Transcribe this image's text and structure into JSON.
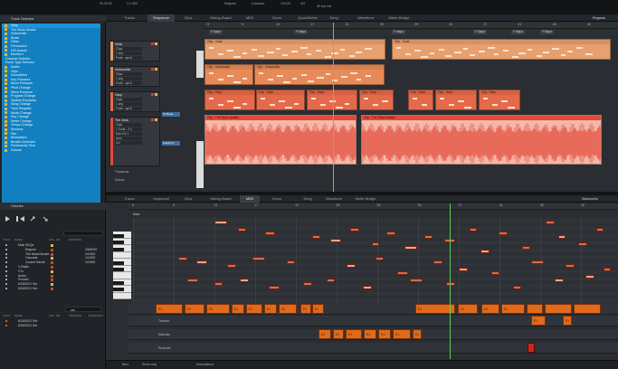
{
  "transport": {
    "time_label": "00:00:00",
    "position_label": "1.1.000",
    "grid_label": "Regions",
    "contour_label": "Contours",
    "tempo_label": "120.00",
    "signature_label": "4/4",
    "cpu_label": "30 bar mit"
  },
  "left_panel": {
    "track_selector_title": "Track Selector",
    "tracks": [
      "Harp",
      "The Moon Awake",
      "Violoncello",
      "Brass",
      "Other",
      "Percussion",
      "DEI Assets",
      "Monitor I"
    ],
    "channel_selector": "Channel Selector",
    "event_type_selector": "Event Type Selector",
    "event_types": [
      "Notes",
      "Clips",
      "Soundbites",
      "Key Pressure",
      "Micro Pressure",
      "Pitch Change",
      "Micro Pressure",
      "Program Change",
      "System Exclusive",
      "Song Change",
      "Tune Request",
      "Mode Change",
      "Key Change",
      "Meter Change",
      "Tempo Change",
      "Streams",
      "Pan",
      "Modulation",
      "Breath Controller",
      "Portamento Time",
      "Volume"
    ],
    "chunks_title": "Chunks",
    "chunks_columns": [
      "PLAY",
      "NAME",
      "COL",
      "SR",
      "POSITION"
    ],
    "chunks": [
      {
        "name": "Main SKQs",
        "pos": ""
      },
      {
        "name": "Regnes",
        "pos": "4/6/2020"
      },
      {
        "name": "The Moon/Awake",
        "pos": "1/1/000"
      },
      {
        "name": "Cascada",
        "pos": "1/1/000"
      },
      {
        "name": "Cursed Hands",
        "pos": "1/1/000"
      },
      {
        "name": "V-Radio",
        "pos": ""
      },
      {
        "name": "V7s",
        "pos": ""
      },
      {
        "name": "Audio",
        "pos": ""
      },
      {
        "name": "Presets",
        "pos": ""
      },
      {
        "name": "6/25/2021 Ser",
        "pos": ""
      },
      {
        "name": "6/30/2021 Ser",
        "pos": ""
      }
    ],
    "search_placeholder": "set",
    "chunks2_columns": [
      "PLAY",
      "NAME",
      "COL",
      "SR",
      "POSITION",
      "DURATION"
    ],
    "chunks2": [
      {
        "name": "6/25/2021 Set"
      },
      {
        "name": "6/30/2021 Set"
      }
    ]
  },
  "top_tabs": [
    "Tracks",
    "Sequence",
    "Clips",
    "Mixing Board",
    "MIDI",
    "Drum",
    "QuickScribe",
    "Song",
    "Waveform",
    "Meter Bridge"
  ],
  "top_tab_active": "Sequence",
  "top_right_label": "Regress",
  "ruler_top": [
    "5",
    "9",
    "13",
    "17",
    "21",
    "25",
    "29",
    "33",
    "37",
    "41",
    "45",
    "49"
  ],
  "markers_top": [
    "F Major",
    "F Major",
    "F Major",
    "F Major",
    "F Major",
    "F Major"
  ],
  "tracks": [
    {
      "name": "Viola",
      "rows": [
        "Clips",
        "1 any",
        "Forte - apr.6"
      ],
      "clips": [
        {
          "label": "Clip - Viola"
        },
        {
          "label": "Clip - Viola"
        }
      ]
    },
    {
      "name": "Violoncello",
      "rows": [
        "Clips",
        "1 any",
        "Forte - apr.6"
      ],
      "clips": [
        {
          "label": "Clip - Violoncello"
        },
        {
          "label": "Clip - Violoncello"
        }
      ]
    },
    {
      "name": "Harp",
      "rows": [
        "Clips",
        "1 any",
        "Forte - apr.6"
      ],
      "clips": [
        {
          "label": "Clip - Harp"
        },
        {
          "label": "Clip - Harp"
        },
        {
          "label": "Clip - Harp"
        },
        {
          "label": "Clip - Harp"
        },
        {
          "label": "Clip - Harp"
        },
        {
          "label": "Clip - Harp"
        },
        {
          "label": "Clip - Harp"
        }
      ]
    },
    {
      "name": "The Jens",
      "rows": [
        "Clips",
        "1 Forte - 3.4",
        "Mon Ov 1",
        "Auto",
        "Vol"
      ],
      "clips": [
        {
          "label": "Clip - The Moon Awake"
        },
        {
          "label": "Clip - The Moon Awake"
        }
      ]
    }
  ],
  "track_inserts": {
    "harp": "Vt Mods",
    "thejens": "FoolIt v.1"
  },
  "transpose_label": "Transpose",
  "detune_label": "Detune",
  "bottom_tabs": [
    "Tracks",
    "Sequence",
    "Clips",
    "Mixing Board",
    "MIDI",
    "Drum",
    "Song",
    "Waveform",
    "Meter Bridge"
  ],
  "bottom_tab_active": "MIDI",
  "bottom_right_label": "Violoncello",
  "ruler_bottom": [
    "5",
    "9",
    "13",
    "17",
    "21",
    "25",
    "29",
    "33",
    "37",
    "41",
    "45",
    "49"
  ],
  "piano_label": "Main",
  "articulations": [
    {
      "label": "Legato",
      "blocks": [
        "E1",
        "E1",
        "E1",
        "E1",
        "E1",
        "E1",
        "E1",
        "E1",
        "E1",
        "E1",
        "E1",
        "E1",
        "E1"
      ]
    },
    {
      "label": "Tremolo",
      "blocks": [
        "E1",
        "E1"
      ]
    },
    {
      "label": "Staccato",
      "blocks": [
        "E1",
        "E1",
        "E1",
        "E1",
        "E1",
        "E1",
        "E1"
      ]
    },
    {
      "label": "Pizzicato",
      "blocks": []
    }
  ],
  "status": {
    "bars": "Bars",
    "show": "Show only",
    "articulations": "Articulations"
  },
  "colors": {
    "accent_blue": "#127fc0",
    "clip_orange": "#e8a06e",
    "clip_dark": "#e06a1d",
    "audio_red": "#e34a3a",
    "playhead": "#5ad04a"
  }
}
